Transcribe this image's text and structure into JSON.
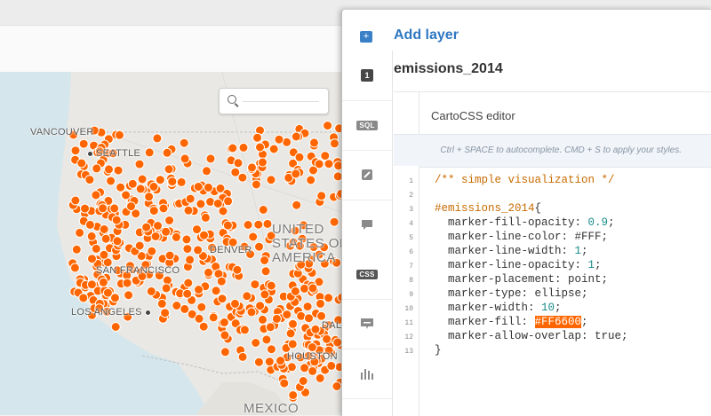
{
  "map": {
    "search_placeholder": "",
    "labels": {
      "vancouver": "VANCOUVER",
      "seattle": "SEATTLE",
      "denver": "DENVER",
      "san_francisco": "SAN FRANCISCO",
      "los_angeles": "LOS ANGELES",
      "dallas": "DALL",
      "houston": "HOUSTON",
      "country_line1": "UNITED",
      "country_line2": "STATES OF",
      "country_line3": "AMERICA",
      "mexico": "MEXICO"
    },
    "marker_color": "#FF6600"
  },
  "panel": {
    "add_layer_label": "Add layer",
    "layer_index": "1",
    "layer_name": "emissions_2014",
    "rail": [
      {
        "name": "layer-index",
        "icon": "layer-number-badge"
      },
      {
        "name": "sql",
        "icon": "SQL"
      },
      {
        "name": "wizard",
        "icon": "brush-icon"
      },
      {
        "name": "infowindow",
        "icon": "speech-bubble-icon"
      },
      {
        "name": "css",
        "icon": "CSS"
      },
      {
        "name": "legend",
        "icon": "legend-icon"
      },
      {
        "name": "filters",
        "icon": "bar-chart-icon"
      }
    ],
    "rail_sql": "SQL",
    "rail_css": "CSS",
    "editor_title": "CartoCSS editor",
    "hint": "Ctrl + SPACE to autocomplete. CMD + S to apply your styles.",
    "line_numbers": [
      "1",
      "2",
      "3",
      "4",
      "5",
      "6",
      "7",
      "8",
      "9",
      "10",
      "11",
      "12",
      "13"
    ],
    "code": {
      "l1": "/** simple visualization */",
      "l3_sel": "#emissions_2014",
      "l3_brace": "{",
      "l4_prop": "  marker-fill-opacity: ",
      "l4_val": "0.9",
      "l5_prop": "  marker-line-color: #FFF;",
      "l6_prop": "  marker-line-width: ",
      "l6_val": "1",
      "l7_prop": "  marker-line-opacity: ",
      "l7_val": "1",
      "l8": "  marker-placement: point;",
      "l9": "  marker-type: ellipse;",
      "l10_prop": "  marker-width: ",
      "l10_val": "10",
      "l11_prop": "  marker-fill: ",
      "l11_val": "#FF6600",
      "l12": "  marker-allow-overlap: true;",
      "l13": "}"
    }
  }
}
